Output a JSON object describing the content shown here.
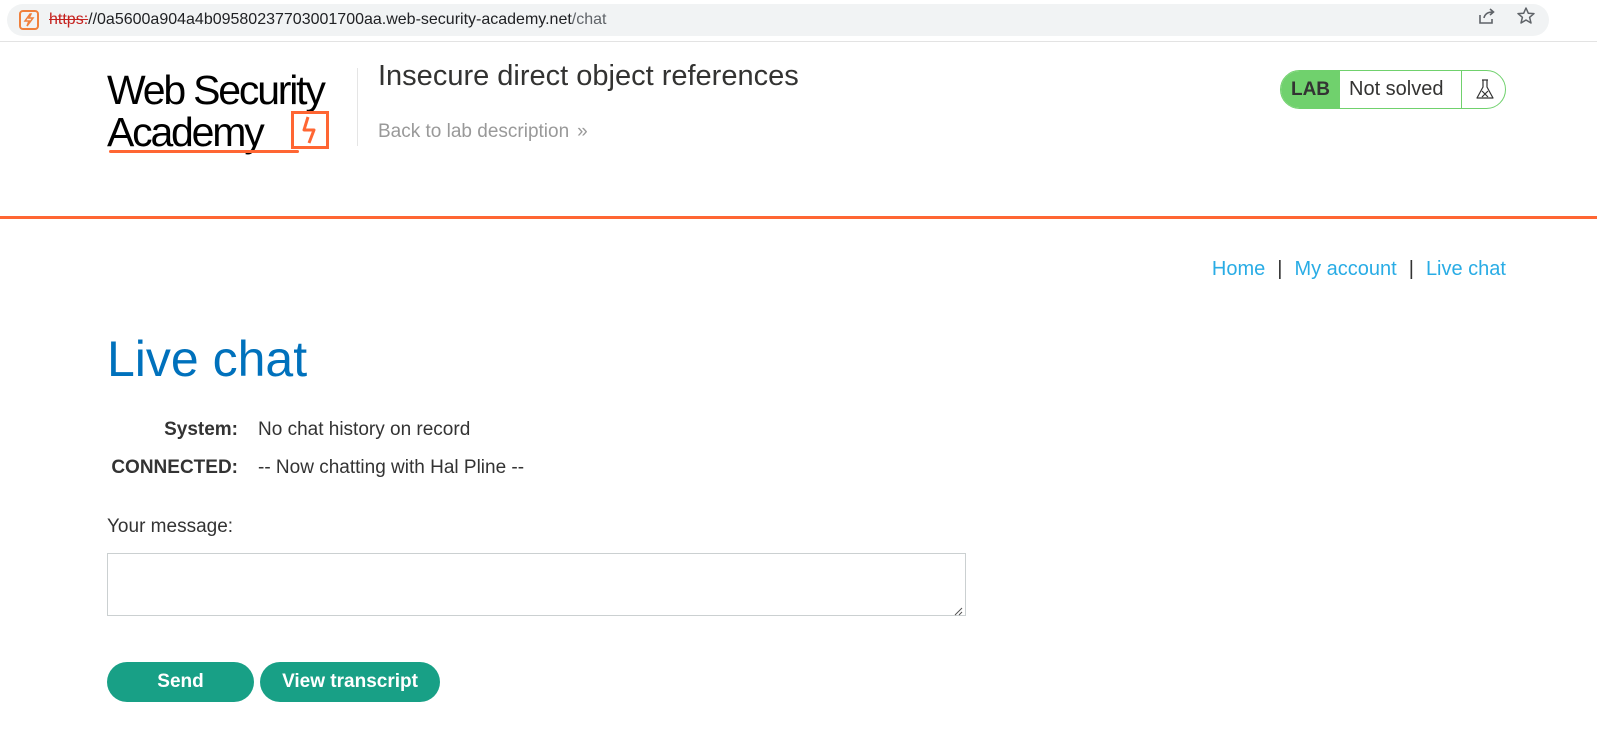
{
  "browser": {
    "url_scheme": "https:",
    "url_host": "//0a5600a904a4b0958023770300​1700aa.web-security-academy.net",
    "url_path": "/chat",
    "icons": [
      "site-icon",
      "share-icon",
      "star-icon"
    ]
  },
  "header": {
    "logo_line1": "Web Security",
    "logo_line2": "Academy",
    "lab_title": "Insecure direct object references",
    "back_link": "Back to lab description",
    "lab_status_tag": "LAB",
    "lab_status_text": "Not solved"
  },
  "nav": {
    "home": "Home",
    "separator": "|",
    "my_account": "My account",
    "live_chat": "Live chat"
  },
  "main": {
    "title": "Live chat",
    "chat": [
      {
        "who": "System:",
        "message": "No chat history on record"
      },
      {
        "who": "CONNECTED:",
        "message": "-- Now chatting with Hal Pline --"
      }
    ],
    "message_label": "Your message:",
    "message_value": "",
    "send_label": "Send",
    "transcript_label": "View transcript"
  },
  "colors": {
    "accent_orange": "#ff6633",
    "title_blue": "#0071bc",
    "link_blue": "#29ace5",
    "lab_green": "#70d16d",
    "button_teal": "#18a086"
  }
}
